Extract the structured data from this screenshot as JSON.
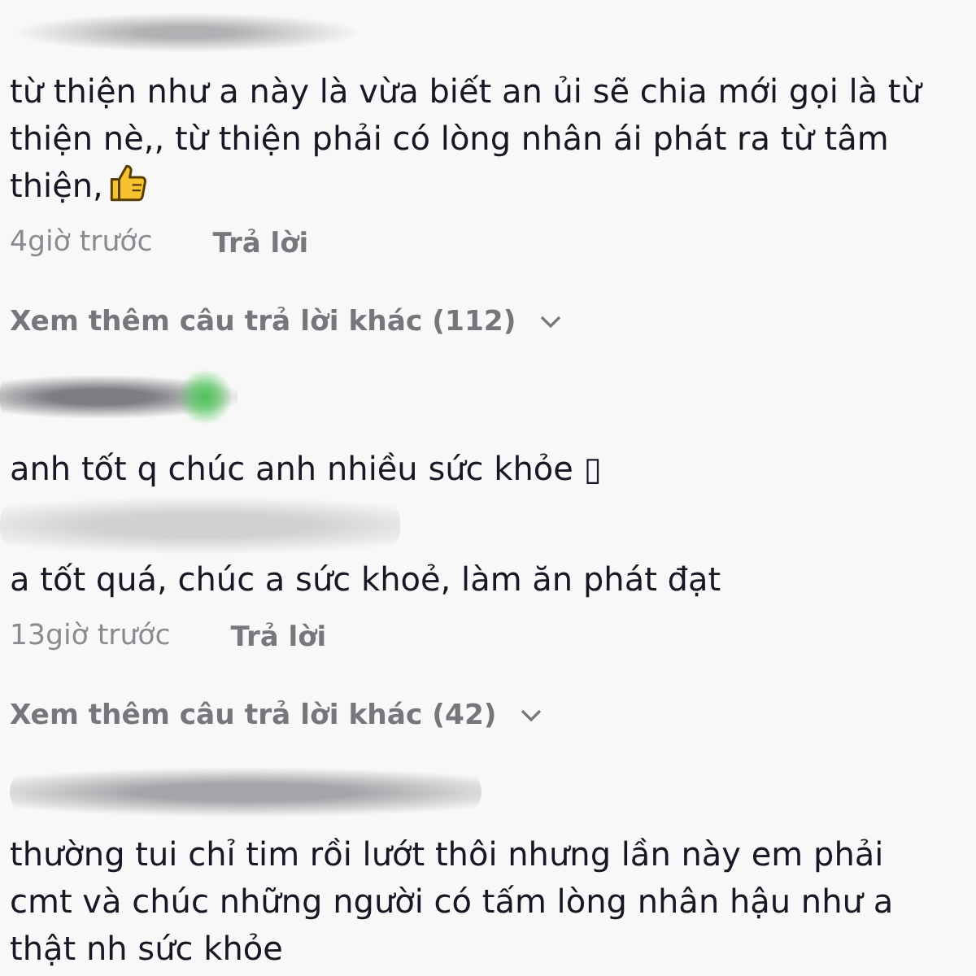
{
  "comments": [
    {
      "kind": "medium",
      "text": "từ thiện như a này là vừa biết an ủi sẽ chia mới gọi là từ thiện nè,, từ thiện phải có lòng nhân ái phát ra từ tâm thiện,",
      "emoji": true,
      "time": "4giờ trước",
      "reply": "Trả lời",
      "more_replies": "Xem thêm câu trả lời khác (112)"
    },
    {
      "kind": "green",
      "text": "anh tốt q chúc anh nhiều sức khỏe ▯",
      "emoji": false
    },
    {
      "kind": "faint",
      "text": "a tốt quá, chúc a sức khoẻ, làm ăn phát đạt",
      "emoji": false,
      "time": "13giờ trước",
      "reply": "Trả lời",
      "more_replies": "Xem thêm câu trả lời khác (42)"
    },
    {
      "kind": "long",
      "text": "thường tui chỉ tim rồi lướt thôi nhưng lần này em phải cmt và chúc những người có tấm lòng nhân hậu như a thật nh sức khỏe",
      "emoji": false
    }
  ]
}
